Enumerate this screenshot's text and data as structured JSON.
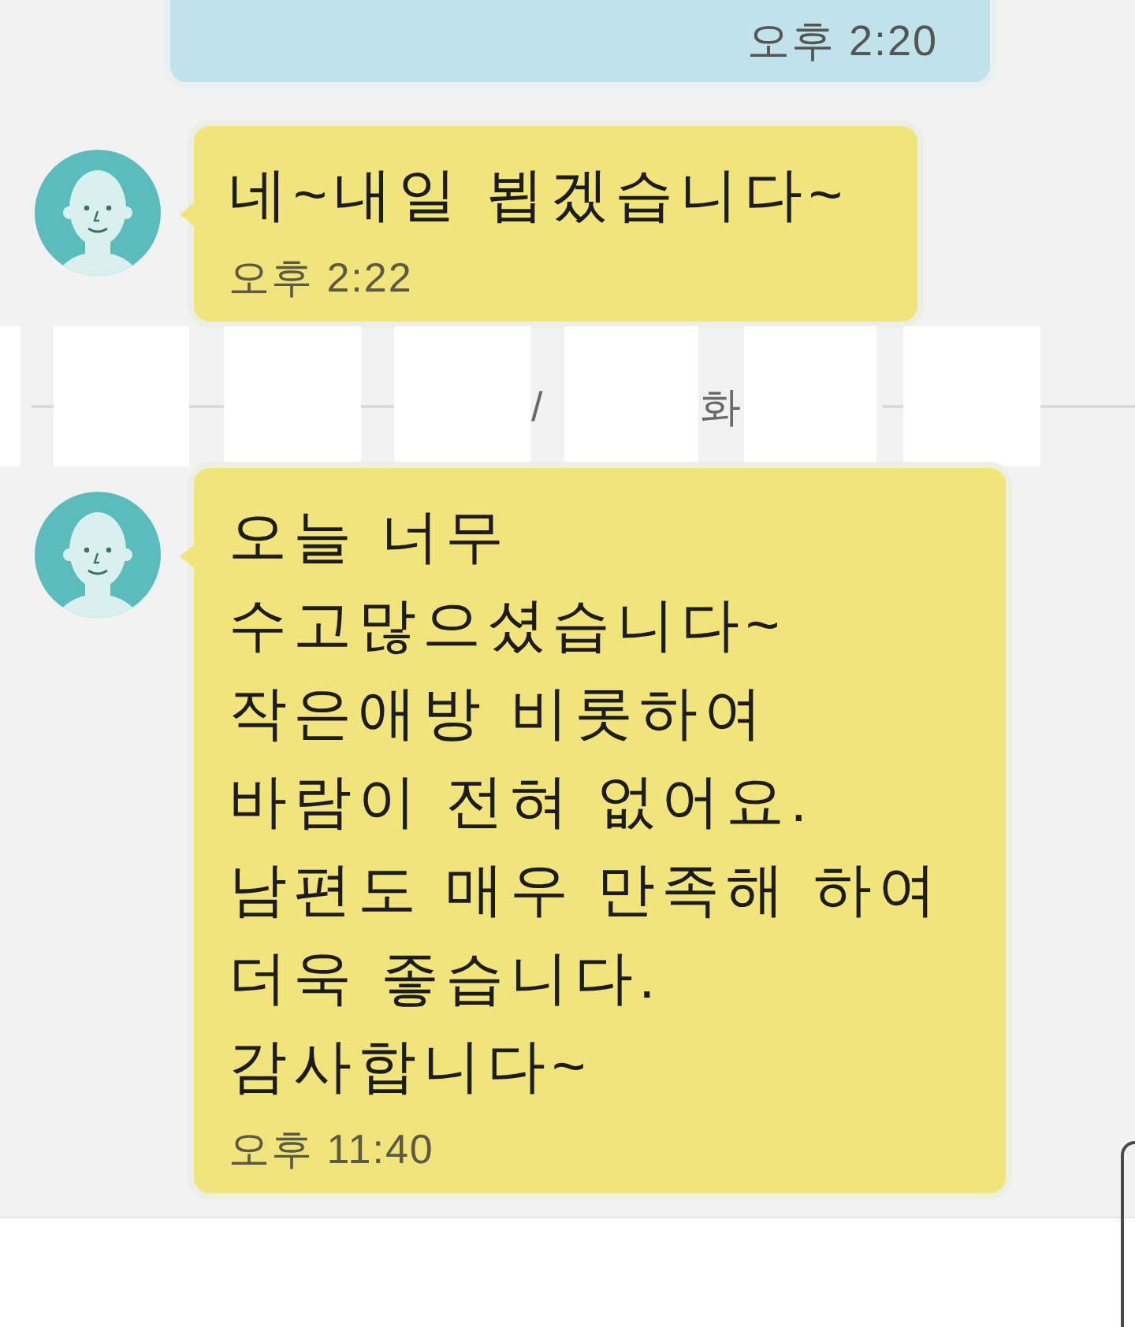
{
  "chat": {
    "messages": [
      {
        "kind": "outgoing",
        "time": "오후 2:20"
      },
      {
        "kind": "incoming",
        "text": "네~내일 뵙겠습니다~",
        "time": "오후 2:22"
      },
      {
        "kind": "date_divider",
        "fragments": [
          "/",
          "화"
        ],
        "redacted": true
      },
      {
        "kind": "incoming",
        "text": "오늘 너무\n수고많으셨습니다~\n작은애방 비롯하여\n바람이 전혀 없어요.\n남편도 매우 만족해 하여\n더욱 좋습니다.\n감사합니다~",
        "time": "오후 11:40"
      }
    ]
  }
}
